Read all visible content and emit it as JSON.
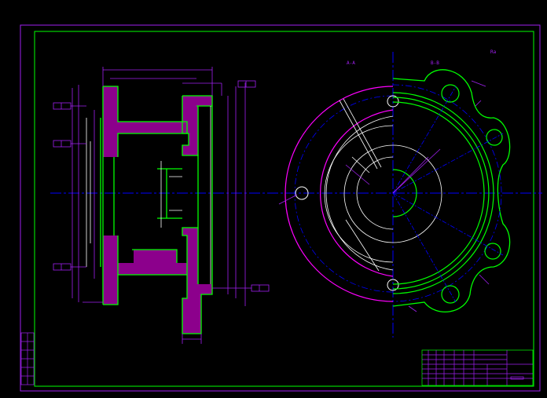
{
  "drawing": {
    "view_label_left": "A-A",
    "view_label_right": "B-B",
    "roughness_note": "Ra",
    "title_block_text": "",
    "colors": {
      "background": "#000000",
      "border": "#00ff00",
      "outer_frame": "#a020f0",
      "part_outline": "#00ff00",
      "dimension": "#a020f0",
      "centerline": "#0000ff",
      "hidden_circle": "#ff00ff",
      "hatch": "#ff00ff",
      "white_lines": "#ffffff"
    }
  }
}
